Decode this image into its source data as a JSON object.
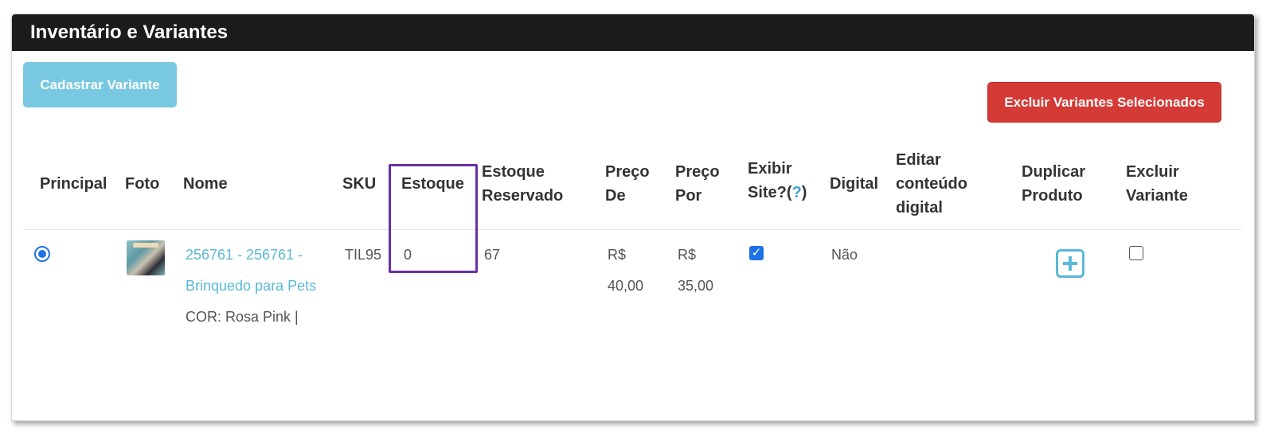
{
  "panel": {
    "title": "Inventário e Variantes"
  },
  "actions": {
    "add_variant": "Cadastrar Variante",
    "delete_selected": "Excluir Variantes Selecionados"
  },
  "table": {
    "headers": {
      "principal": "Principal",
      "foto": "Foto",
      "nome": "Nome",
      "sku": "SKU",
      "estoque": "Estoque",
      "estoque_reservado_1": "Estoque",
      "estoque_reservado_2": "Reservado",
      "preco_de_1": "Preço",
      "preco_de_2": "De",
      "preco_por_1": "Preço",
      "preco_por_2": "Por",
      "exibir_1": "Exibir",
      "exibir_2a": "Site?(",
      "exibir_q": "?",
      "exibir_2b": ")",
      "digital": "Digital",
      "editar_1": "Editar",
      "editar_2": "conteúdo",
      "editar_3": "digital",
      "duplicar_1": "Duplicar",
      "duplicar_2": "Produto",
      "excluir_1": "Excluir",
      "excluir_2": "Variante"
    },
    "rows": [
      {
        "nome_line1": "256761 - 256761 -",
        "nome_line2": "Brinquedo para Pets",
        "attributes": "COR: Rosa Pink |",
        "sku": "TIL95",
        "estoque": "0",
        "estoque_reservado": "67",
        "preco_de_currency": "R$",
        "preco_de_value": "40,00",
        "preco_por_currency": "R$",
        "preco_por_value": "35,00",
        "exibir_site": true,
        "digital": "Não",
        "principal_selected": true,
        "excluir_checked": false
      }
    ]
  },
  "colors": {
    "header_bg": "#1b1b1b",
    "add_button": "#79c8e1",
    "delete_button": "#d43a36",
    "link": "#5ab8d9",
    "highlight": "#6b2fa3",
    "check_blue": "#1e72e6"
  },
  "icons": {
    "duplicate": "plus-square-icon",
    "checkbox_checked": "checkmark-icon"
  }
}
